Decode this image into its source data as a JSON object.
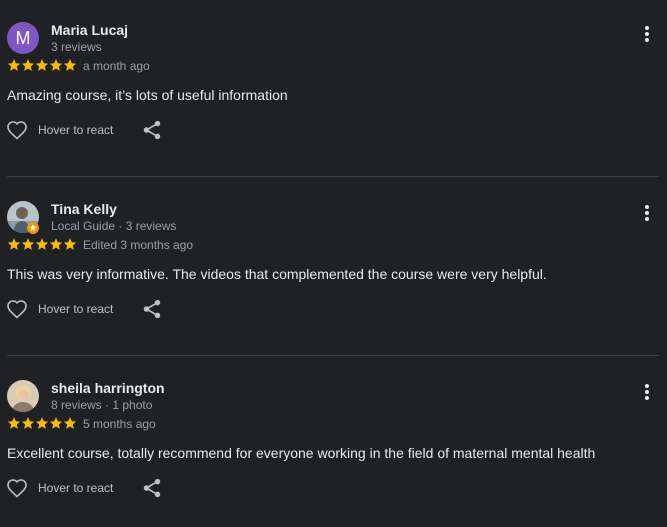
{
  "reviews": [
    {
      "name": "Maria Lucaj",
      "avatar_letter": "M",
      "meta": "3 reviews",
      "rating": 5,
      "date": "a month ago",
      "text": "Amazing course, it’s lots of useful information",
      "react_label": "Hover to react"
    },
    {
      "name": "Tina Kelly",
      "meta": "Local Guide · 3 reviews",
      "rating": 5,
      "date": "Edited 3 months ago",
      "text": "This was very informative. The videos that complemented the course were very helpful.",
      "react_label": "Hover to react"
    },
    {
      "name": "sheila harrington",
      "meta": "8 reviews · 1 photo",
      "rating": 5,
      "date": "5 months ago",
      "text": "Excellent course, totally recommend for everyone working in the field of maternal mental health",
      "react_label": "Hover to react"
    }
  ],
  "colors": {
    "background": "#202124",
    "star": "#fbbc04",
    "divider": "#3c4043",
    "avatar_letter_bg": "#7e57c2",
    "local_guide_badge": "#f29900"
  },
  "icons": [
    "more-vert-icon",
    "heart-icon",
    "share-icon",
    "star-icon",
    "local-guide-badge-icon"
  ]
}
